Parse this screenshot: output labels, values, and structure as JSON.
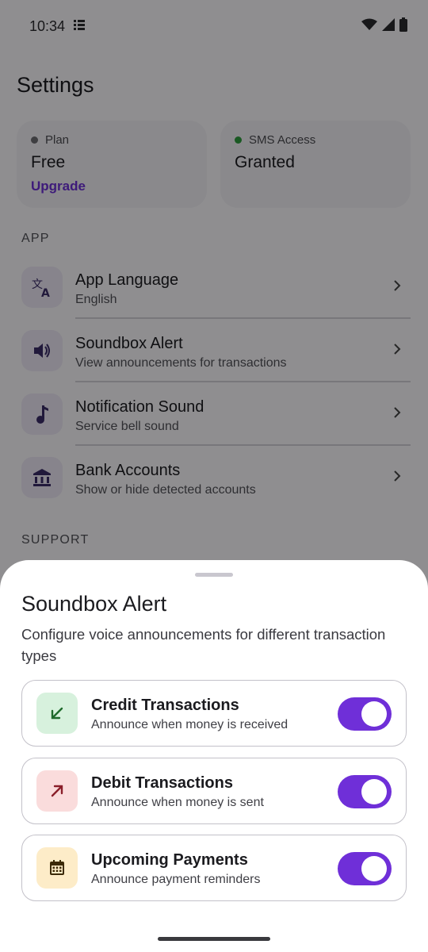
{
  "status_bar": {
    "time": "10:34"
  },
  "settings": {
    "title": "Settings",
    "plan_card": {
      "label": "Plan",
      "value": "Free",
      "action": "Upgrade",
      "dot_color": "#6b6b70"
    },
    "sms_card": {
      "label": "SMS Access",
      "value": "Granted",
      "dot_color": "#2e9a3d"
    },
    "app_section": "APP",
    "app_items": [
      {
        "icon": "translate-icon",
        "title": "App Language",
        "subtitle": "English"
      },
      {
        "icon": "speaker-icon",
        "title": "Soundbox Alert",
        "subtitle": "View announcements for transactions"
      },
      {
        "icon": "music-note-icon",
        "title": "Notification Sound",
        "subtitle": "Service bell sound"
      },
      {
        "icon": "bank-icon",
        "title": "Bank Accounts",
        "subtitle": "Show or hide detected accounts"
      }
    ],
    "support_section": "SUPPORT"
  },
  "sheet": {
    "title": "Soundbox Alert",
    "description": "Configure voice announcements for different transaction types",
    "options": [
      {
        "icon": "arrow-down-left-icon",
        "title": "Credit Transactions",
        "subtitle": "Announce when money is received",
        "enabled": true,
        "icon_bg": "#d7f1dd",
        "icon_color": "#1f6a2c"
      },
      {
        "icon": "arrow-up-right-icon",
        "title": "Debit Transactions",
        "subtitle": "Announce when money is sent",
        "enabled": true,
        "icon_bg": "#fadcdc",
        "icon_color": "#8a1f2a"
      },
      {
        "icon": "calendar-icon",
        "title": "Upcoming Payments",
        "subtitle": "Announce payment reminders",
        "enabled": true,
        "icon_bg": "#fdecc8",
        "icon_color": "#3b2a06"
      }
    ],
    "toggle_color": "#6f2fd8"
  }
}
